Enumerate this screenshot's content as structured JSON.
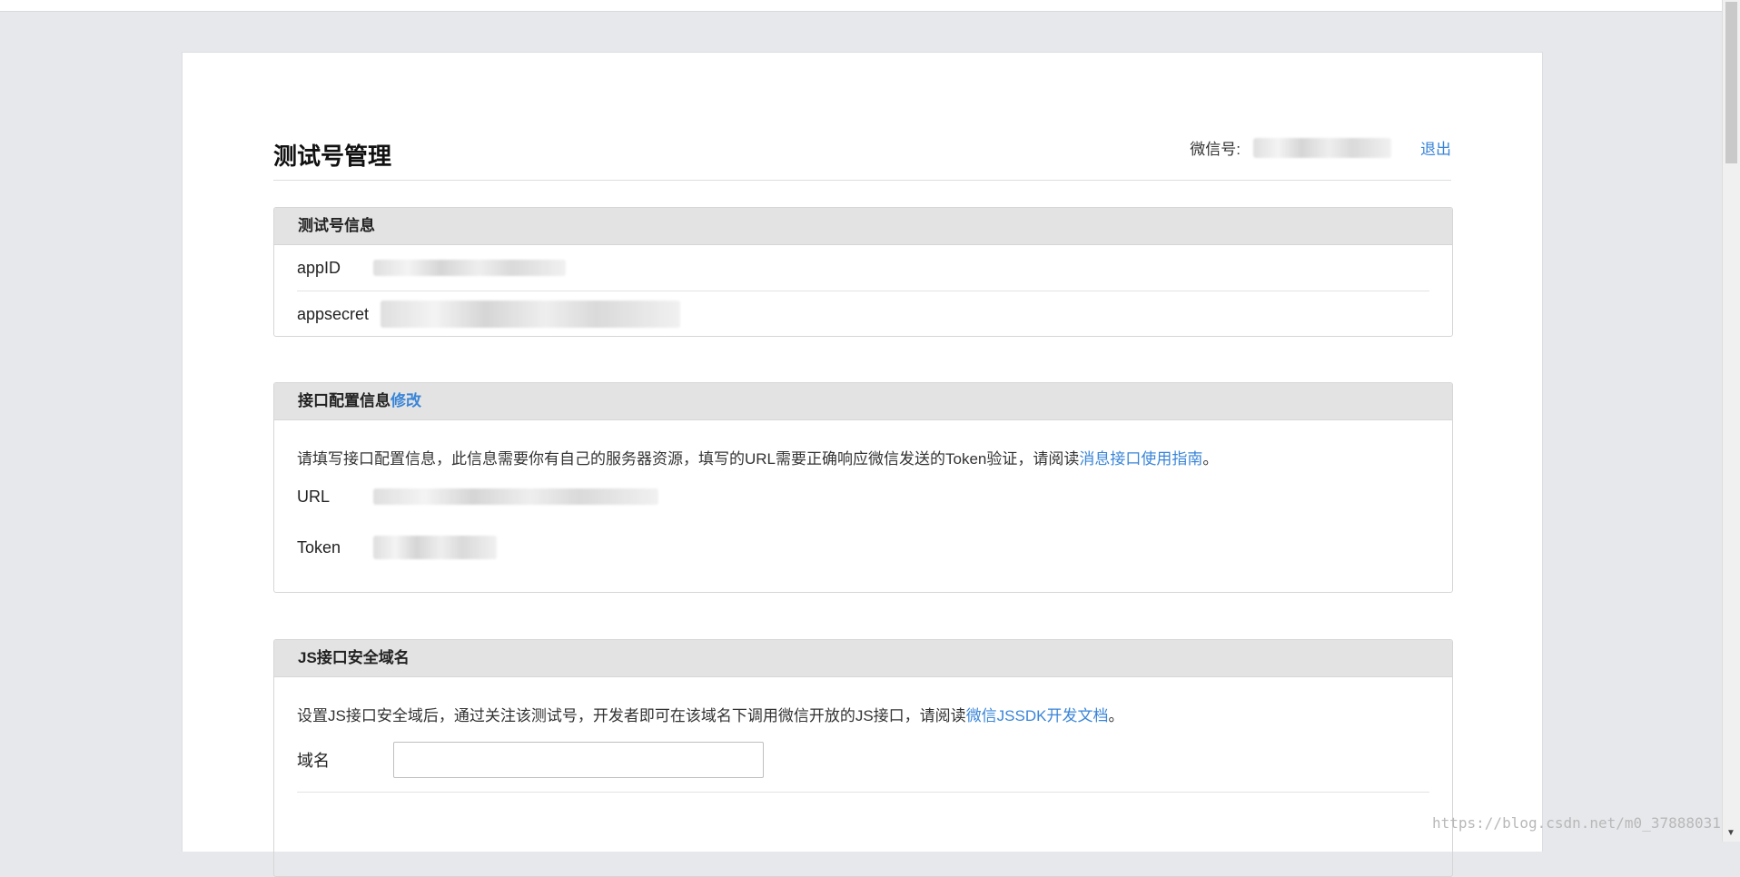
{
  "page": {
    "title": "测试号管理",
    "wechat_label": "微信号:",
    "logout_label": "退出"
  },
  "account_info": {
    "title": "测试号信息",
    "appid_label": "appID",
    "appsecret_label": "appsecret"
  },
  "interface_config": {
    "title": "接口配置信息",
    "edit_label": "修改",
    "description": "请填写接口配置信息，此信息需要你有自己的服务器资源，填写的URL需要正确响应微信发送的Token验证，请阅读",
    "guide_link": "消息接口使用指南",
    "description_end": "。",
    "url_label": "URL",
    "token_label": "Token"
  },
  "js_domain": {
    "title": "JS接口安全域名",
    "description": "设置JS接口安全域后，通过关注该测试号，开发者即可在该域名下调用微信开放的JS接口，请阅读",
    "doc_link": "微信JSSDK开发文档",
    "description_end": "。",
    "domain_label": "域名",
    "domain_value": ""
  },
  "watermark": "https://blog.csdn.net/m0_37888031",
  "colors": {
    "link": "#3a85d8",
    "panel_header": "#e3e3e3",
    "background": "#e7e8eb"
  }
}
